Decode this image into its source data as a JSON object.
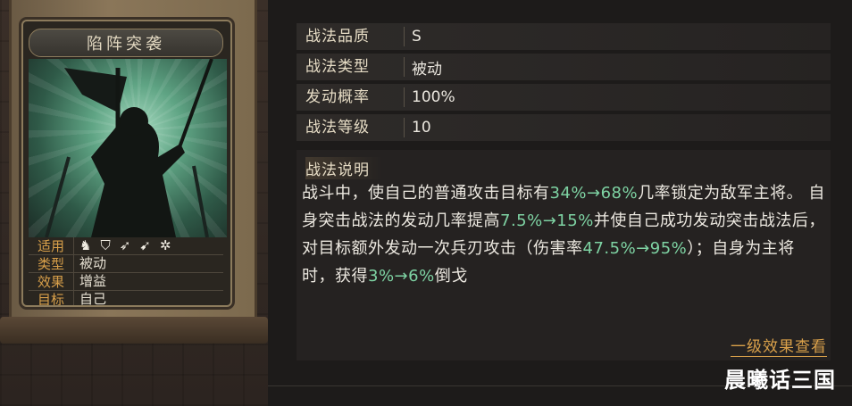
{
  "card": {
    "title": "陷阵突袭",
    "stats": [
      {
        "key": "适用",
        "value": ""
      },
      {
        "key": "类型",
        "value": "被动"
      },
      {
        "key": "效果",
        "value": "增益"
      },
      {
        "key": "目标",
        "value": "自己"
      }
    ],
    "troop_icons": [
      "horse-icon",
      "shield-icon",
      "bow-icon",
      "spear-icon",
      "wheel-icon"
    ]
  },
  "info": [
    {
      "key": "战法品质",
      "value": "S"
    },
    {
      "key": "战法类型",
      "value": "被动"
    },
    {
      "key": "发动概率",
      "value": "100%"
    },
    {
      "key": "战法等级",
      "value": "10"
    }
  ],
  "description": {
    "title": "战法说明",
    "segments": [
      {
        "t": "战斗中，使自己的普通攻击目标有",
        "hl": false
      },
      {
        "t": "34%→68%",
        "hl": true
      },
      {
        "t": "几率锁定为敌军主将。 自身突击战法的发动几率提高",
        "hl": false
      },
      {
        "t": "7.5%→15%",
        "hl": true
      },
      {
        "t": "并使自己成功发动突击战法后，对目标额外发动一次兵刃攻击（伤害率",
        "hl": false
      },
      {
        "t": "47.5%→95%",
        "hl": true
      },
      {
        "t": "）；自身为主将时，获得",
        "hl": false
      },
      {
        "t": "3%→6%",
        "hl": true
      },
      {
        "t": "倒戈",
        "hl": false
      }
    ]
  },
  "more_link": "一级效果查看",
  "watermark": "晨曦话三国",
  "colors": {
    "highlight": "#7ed3a3",
    "accent": "#d9a04a"
  }
}
